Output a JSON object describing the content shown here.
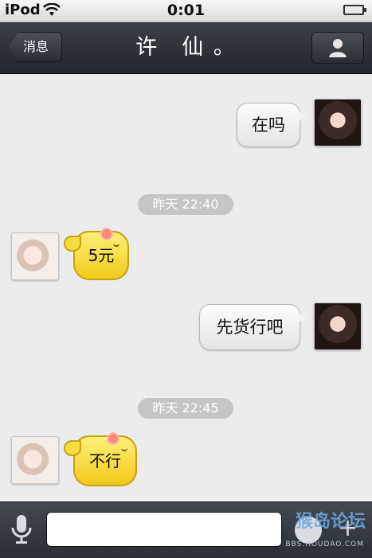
{
  "status_bar": {
    "carrier": "iPod",
    "time": "0:01"
  },
  "nav": {
    "back_label": "消息",
    "title": "许　仙 。"
  },
  "messages": {
    "m1": {
      "text": "在吗"
    },
    "t1": {
      "text": "昨天 22:40"
    },
    "m2": {
      "text": "5元"
    },
    "m3": {
      "text": "先货行吧"
    },
    "t2": {
      "text": "昨天 22:45"
    },
    "m4": {
      "text": "不行"
    }
  },
  "input": {
    "placeholder": ""
  },
  "watermark": {
    "text": "猴岛论坛",
    "url": "BBS.HOUDAO.COM"
  },
  "colors": {
    "incoming_bubble": "#f7dc3d",
    "outgoing_bubble": "#f2f2f2",
    "nav_bg": "#2b2f35",
    "chat_bg": "#ececed"
  }
}
